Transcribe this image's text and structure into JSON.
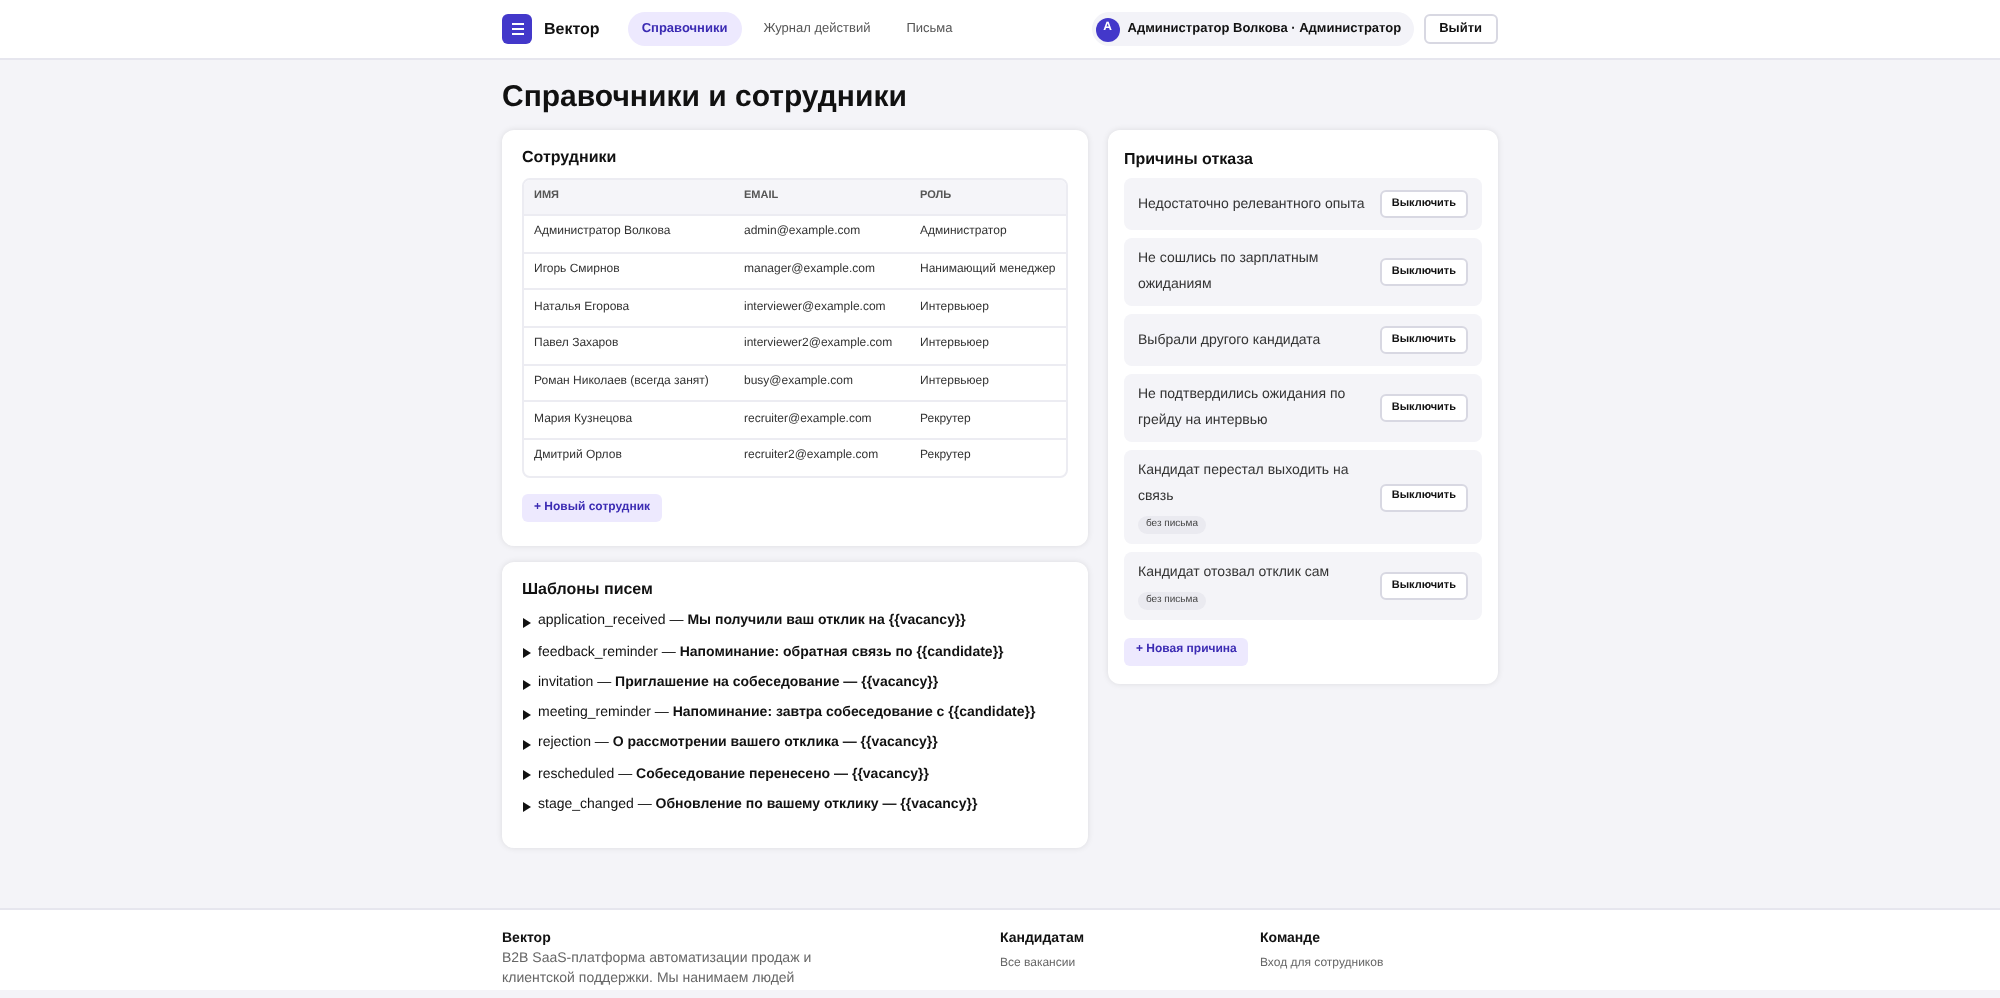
{
  "header": {
    "brand": "Вектор",
    "nav": [
      {
        "label": "Справочники",
        "selected": true
      },
      {
        "label": "Журнал действий",
        "selected": false
      },
      {
        "label": "Письма",
        "selected": false
      }
    ],
    "user": {
      "initial": "А",
      "label": "Администратор Волкова · Администратор"
    },
    "logout": "Выйти"
  },
  "page_title": "Справочники и сотрудники",
  "employees": {
    "title": "Сотрудники",
    "columns": [
      "ИМЯ",
      "EMAIL",
      "РОЛЬ"
    ],
    "rows": [
      [
        "Администратор Волкова",
        "admin@example.com",
        "Администратор"
      ],
      [
        "Игорь Смирнов",
        "manager@example.com",
        "Нанимающий менеджер"
      ],
      [
        "Наталья Егорова",
        "interviewer@example.com",
        "Интервьюер"
      ],
      [
        "Павел Захаров",
        "interviewer2@example.com",
        "Интервьюер"
      ],
      [
        "Роман Николаев (всегда занят)",
        "busy@example.com",
        "Интервьюер"
      ],
      [
        "Мария Кузнецова",
        "recruiter@example.com",
        "Рекрутер"
      ],
      [
        "Дмитрий Орлов",
        "recruiter2@example.com",
        "Рекрутер"
      ]
    ],
    "add_button": "+ Новый сотрудник"
  },
  "templates": {
    "title": "Шаблоны писем",
    "items": [
      {
        "summary": "application_received — **Мы получили ваш отклик на {{vacancy}}**",
        "expanded": false
      },
      {
        "summary": "feedback_reminder — **Напоминание: обратная связь по {{candidate}}**",
        "expanded": false
      },
      {
        "summary": "invitation — **Приглашение на собеседование — {{vacancy}}**",
        "expanded": false
      },
      {
        "summary": "meeting_reminder — **Напоминание: завтра собеседование с {{candidate}}**",
        "expanded": false
      },
      {
        "summary": "rejection — **О рассмотрении вашего отклика — {{vacancy}}**",
        "expanded": false
      },
      {
        "summary": "rescheduled — **Собеседование перенесено — {{vacancy}}**",
        "expanded": false
      },
      {
        "summary": "stage_changed — **Обновление по вашему отклику — {{vacancy}}**",
        "expanded": false
      }
    ]
  },
  "reasons": {
    "title": "Причины отказа",
    "items": [
      {
        "text": "Недостаточно релевантного опыта",
        "button": "Выключить"
      },
      {
        "text": "Не сошлись по зарплатным ожиданиям",
        "button": "Выключить"
      },
      {
        "text": "Выбрали другого кандидата",
        "button": "Выключить"
      },
      {
        "text": "Не подтвердились ожидания по грейду на интервью",
        "button": "Выключить"
      },
      {
        "text": "Кандидат перестал выходить на связь",
        "tag": "без письма",
        "button": "Выключить"
      },
      {
        "text": "Кандидат отозвал отклик сам",
        "tag": "без письма",
        "button": "Выключить"
      }
    ],
    "add_button": "+ Новая причина"
  },
  "footer": {
    "brand": "Вектор",
    "description": "B2B SaaS-платформа автоматизации продаж и клиентской поддержки. Мы нанимаем людей",
    "columns": [
      {
        "title": "Кандидатам",
        "links": [
          "Все вакансии"
        ]
      },
      {
        "title": "Команде",
        "links": [
          "Вход для сотрудников"
        ]
      }
    ]
  }
}
